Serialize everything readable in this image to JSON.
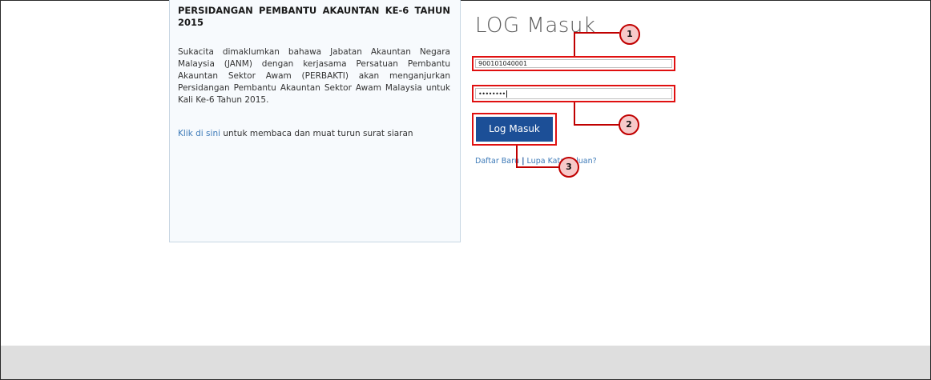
{
  "announcement": {
    "title": "PERSIDANGAN PEMBANTU AKAUNTAN KE-6 TAHUN 2015",
    "body": "Sukacita dimaklumkan bahawa Jabatan Akauntan Negara Malaysia (JANM) dengan kerjasama Persatuan Pembantu Akauntan Sektor Awam (PERBAKTI) akan menganjurkan Persidangan Pembantu Akauntan Sektor Awam Malaysia untuk Kali Ke-6 Tahun 2015.",
    "link_text": "Klik di sini",
    "link_suffix": " untuk membaca dan muat turun surat siaran"
  },
  "login": {
    "title": "LOG Masuk",
    "username_value": "900101040001",
    "password_mask": "••••••••",
    "button_label": "Log Masuk",
    "register_link": "Daftar Baru",
    "separator": "|",
    "forgot_link": "Lupa Kata Laluan?"
  },
  "callouts": [
    "1",
    "2",
    "3"
  ],
  "colors": {
    "highlight": "#e01010",
    "button_bg": "#1c4f97",
    "link": "#3d7ab8",
    "badge_fill": "#f7c9c9"
  }
}
